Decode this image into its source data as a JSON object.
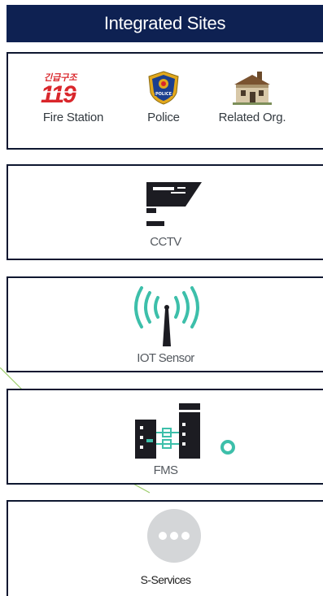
{
  "header": {
    "title": "Integrated Sites"
  },
  "sites": {
    "items": [
      {
        "label": "Fire Station",
        "icon": "fire-station-119-icon",
        "logo_text": "119",
        "logo_subtext": "긴급구조"
      },
      {
        "label": "Police",
        "icon": "police-badge-icon",
        "badge_text": "POLICE"
      },
      {
        "label": "Related Org.",
        "icon": "building-icon"
      }
    ]
  },
  "cctv": {
    "label": "CCTV",
    "icon": "cctv-camera-icon"
  },
  "iot": {
    "label": "IOT Sensor",
    "icon": "wireless-antenna-icon"
  },
  "fms": {
    "label": "FMS",
    "icon": "server-racks-icon"
  },
  "sservices": {
    "label": "S-Services",
    "icon": "more-dots-icon"
  },
  "colors": {
    "header_bg": "#0e2152",
    "border": "#0e1730",
    "accent_teal": "#3dbfaa",
    "fire_red": "#d9262b",
    "police_blue": "#1b3f8f",
    "police_gold": "#e2a81c"
  }
}
